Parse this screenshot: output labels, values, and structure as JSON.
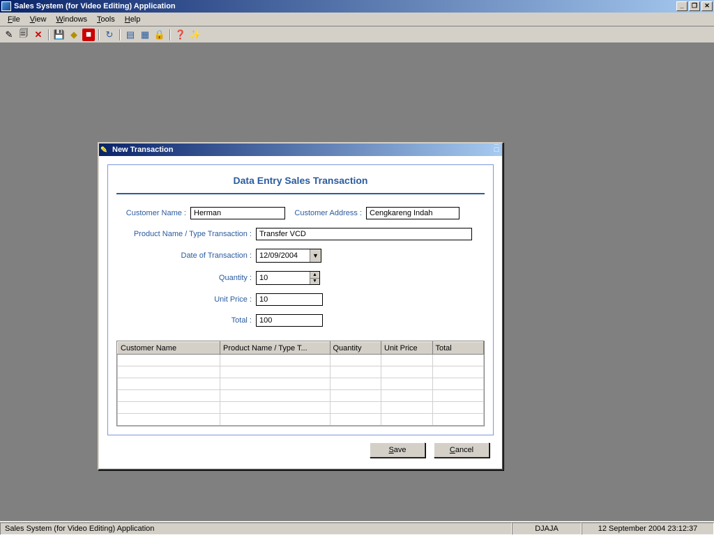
{
  "app": {
    "title": "Sales System (for Video Editing)  Application"
  },
  "menu": {
    "file": "File",
    "view": "View",
    "windows": "Windows",
    "tools": "Tools",
    "help": "Help"
  },
  "dialog": {
    "title": "New Transaction",
    "heading": "Data Entry Sales Transaction",
    "labels": {
      "customer_name": "Customer Name :",
      "customer_address": "Customer Address :",
      "product": "Product Name / Type Transaction :",
      "date": "Date of Transaction :",
      "quantity": "Quantity :",
      "unit_price": "Unit Price :",
      "total": "Total :"
    },
    "values": {
      "customer_name": "Herman",
      "customer_address": "Cengkareng Indah",
      "product": "Transfer VCD",
      "date": "12/09/2004",
      "quantity": "10",
      "unit_price": "10",
      "total": "100"
    },
    "grid_headers": {
      "customer": "Customer Name",
      "product": "Product Name / Type T...",
      "qty": "Quantity",
      "price": "Unit Price",
      "total": "Total"
    },
    "buttons": {
      "save": "Save",
      "cancel": "Cancel"
    }
  },
  "statusbar": {
    "text": "Sales System (for Video Editing) Application",
    "user": "DJAJA",
    "datetime": "12 September 2004  23:12:37"
  }
}
